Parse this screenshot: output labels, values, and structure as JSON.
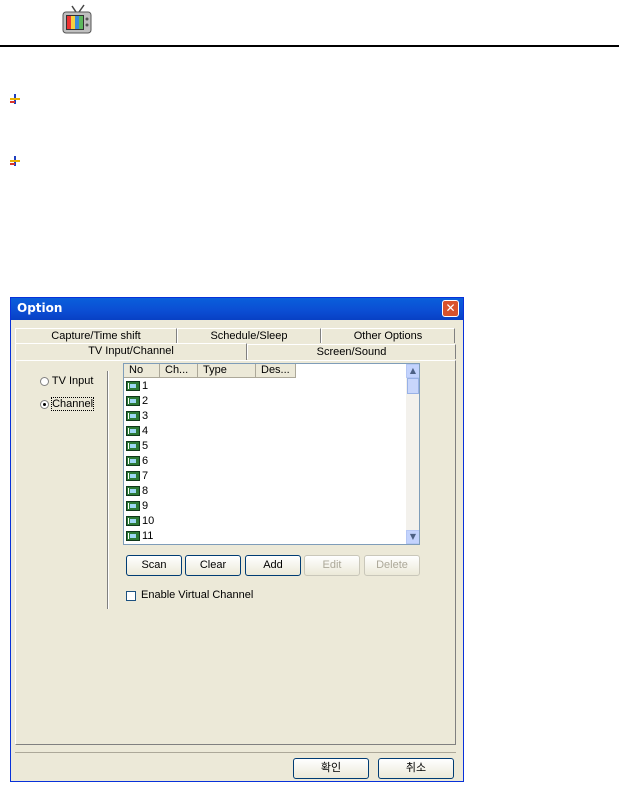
{
  "dialog": {
    "title": "Option",
    "close_glyph": "✕",
    "tabs_back": [
      "Capture/Time shift",
      "Schedule/Sleep",
      "Other Options"
    ],
    "tabs_front": [
      "TV Input/Channel",
      "Screen/Sound"
    ],
    "radios": [
      {
        "label": "TV Input",
        "checked": false
      },
      {
        "label": "Channel",
        "checked": true
      }
    ],
    "list": {
      "columns": [
        "No",
        "Ch...",
        "Type",
        "Des..."
      ],
      "rows": [
        "1",
        "2",
        "3",
        "4",
        "5",
        "6",
        "7",
        "8",
        "9",
        "10",
        "11"
      ]
    },
    "buttons": {
      "scan": "Scan",
      "clear": "Clear",
      "add": "Add",
      "edit": "Edit",
      "delete": "Delete"
    },
    "enable_virtual": "Enable Virtual Channel",
    "ok": "확인",
    "cancel": "취소"
  }
}
